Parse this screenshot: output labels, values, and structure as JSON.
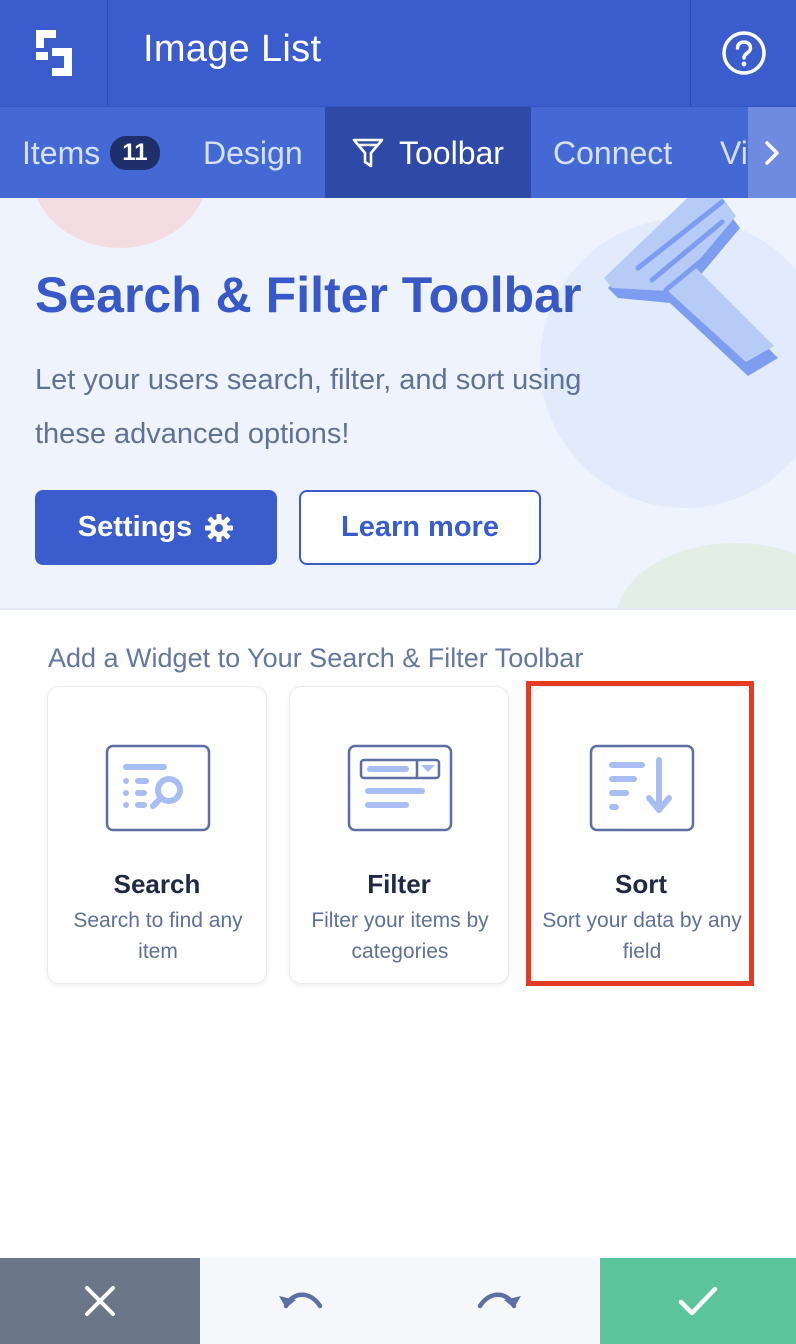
{
  "header": {
    "title": "Image List",
    "logo_icon": "logo-icon",
    "help_icon": "help-circle-icon"
  },
  "tabs": [
    {
      "label": "Items",
      "badge": "11",
      "active": false
    },
    {
      "label": "Design",
      "active": false
    },
    {
      "label": "Toolbar",
      "icon": "funnel-icon",
      "active": true
    },
    {
      "label": "Connect",
      "active": false
    },
    {
      "label": "Vi",
      "active": false
    }
  ],
  "hero": {
    "title": "Search & Filter Toolbar",
    "description": "Let your users search, filter, and sort using these advanced options!",
    "settings_label": "Settings",
    "learn_more_label": "Learn more"
  },
  "widgets": {
    "section_title": "Add a Widget to Your Search & Filter Toolbar",
    "items": [
      {
        "title": "Search",
        "description": "Search to find any item",
        "icon": "search-widget-icon"
      },
      {
        "title": "Filter",
        "description": "Filter your items by categories",
        "icon": "filter-widget-icon"
      },
      {
        "title": "Sort",
        "description": "Sort your data by any field",
        "icon": "sort-widget-icon",
        "highlighted": true
      }
    ]
  },
  "colors": {
    "primary": "#3a5ccc",
    "highlight": "#e53b25",
    "confirm": "#5cc49a",
    "cancel": "#6c7689"
  }
}
